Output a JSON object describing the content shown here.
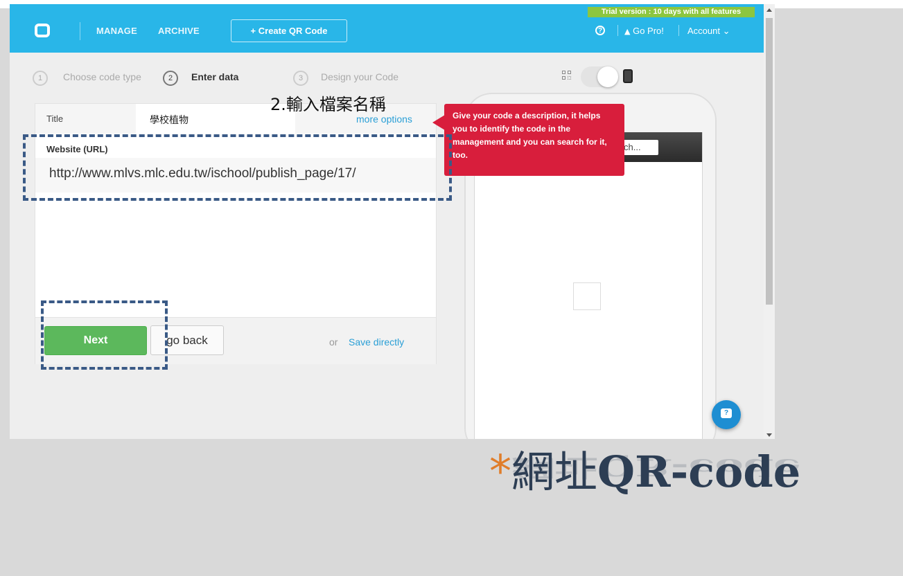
{
  "navbar": {
    "manage_label": "MANAGE",
    "archive_label": "ARCHIVE",
    "create_label": "+ Create QR Code",
    "trial_text": "Trial version : 10 days with all features",
    "help_glyph": "?",
    "go_pro_label": " Go Pro!",
    "cart_glyph": "🛒",
    "account_label": "Account ⌄",
    "accent_color": "#29b6e8"
  },
  "steps": [
    {
      "number": "1",
      "label": "Choose code type"
    },
    {
      "number": "2",
      "label": "Enter data"
    },
    {
      "number": "3",
      "label": "Design your Code"
    }
  ],
  "form": {
    "title_label": "Title",
    "title_value": "學校植物",
    "more_options_label": "more options",
    "url_label": "Website (URL)",
    "url_value": "http://www.mlvs.mlc.edu.tw/ischool/publish_page/17/",
    "next_label": "Next",
    "back_label": "go back",
    "or_text": "or",
    "save_directly_label": "Save directly"
  },
  "tooltip": {
    "text": "Give your code a description, it helps you to identify the code in the management and you can search for it, too.",
    "color": "#d81e3c"
  },
  "preview": {
    "search_placeholder": "ch...",
    "chat_glyph": "?"
  },
  "annotation": {
    "step_note": "2.輸入檔案名稱",
    "dash_color": "#3a5a86"
  },
  "slide_title": {
    "star": "*",
    "cjk": "網址",
    "latin": "QR-code"
  }
}
